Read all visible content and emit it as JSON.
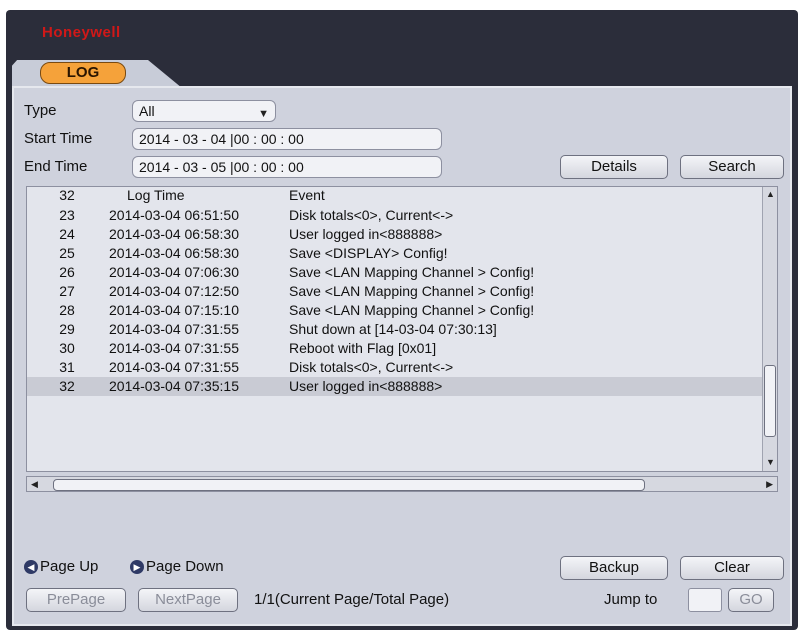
{
  "window": {
    "brand": "Honeywell"
  },
  "tabs": [
    {
      "label": "LOG"
    }
  ],
  "filters": {
    "type_label": "Type",
    "type_value": "All",
    "start_label": "Start Time",
    "start_value": "2014 - 03 - 04 |00 : 00 : 00",
    "end_label": "End Time",
    "end_value": "2014 - 03 - 05 |00 : 00 : 00"
  },
  "buttons": {
    "details": "Details",
    "search": "Search",
    "backup": "Backup",
    "clear": "Clear",
    "prepage": "PrePage",
    "nextpage": "NextPage",
    "go": "GO"
  },
  "table": {
    "headers": {
      "num": "32",
      "time": "Log Time",
      "event": "Event"
    },
    "rows": [
      {
        "num": "23",
        "time": "2014-03-04 06:51:50",
        "event": "Disk totals<0>, Current<->"
      },
      {
        "num": "24",
        "time": "2014-03-04 06:58:30",
        "event": "User logged in<888888>"
      },
      {
        "num": "25",
        "time": "2014-03-04 06:58:30",
        "event": "Save <DISPLAY> Config!"
      },
      {
        "num": "26",
        "time": "2014-03-04 07:06:30",
        "event": "Save <LAN Mapping Channel > Config!"
      },
      {
        "num": "27",
        "time": "2014-03-04 07:12:50",
        "event": "Save <LAN Mapping Channel > Config!"
      },
      {
        "num": "28",
        "time": "2014-03-04 07:15:10",
        "event": "Save <LAN Mapping Channel > Config!"
      },
      {
        "num": "29",
        "time": "2014-03-04 07:31:55",
        "event": "Shut down at [14-03-04 07:30:13]"
      },
      {
        "num": "30",
        "time": "2014-03-04 07:31:55",
        "event": "Reboot with Flag [0x01]"
      },
      {
        "num": "31",
        "time": "2014-03-04 07:31:55",
        "event": "Disk totals<0>, Current<->"
      },
      {
        "num": "32",
        "time": "2014-03-04 07:35:15",
        "event": "User logged in<888888>"
      }
    ]
  },
  "footer": {
    "page_up": "Page Up",
    "page_down": "Page Down",
    "page_status": "1/1(Current Page/Total Page)",
    "jump_label": "Jump to"
  }
}
